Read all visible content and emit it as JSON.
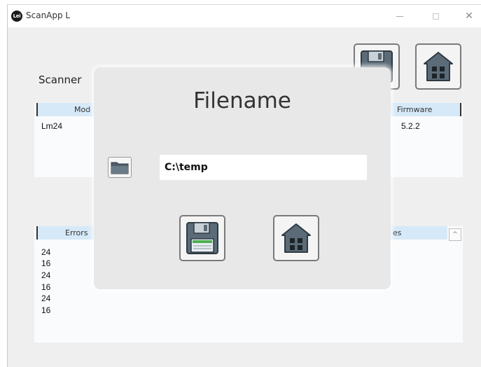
{
  "window": {
    "title": "ScanApp L",
    "icon_text": "Lei",
    "close_glyph": "✕"
  },
  "main": {
    "scanner_label": "Scanner",
    "top_table": {
      "headers": [
        "Mod",
        "Firmware"
      ],
      "rows": [
        [
          "Lm24",
          "5.2.2"
        ]
      ]
    },
    "bottom_table": {
      "headers": [
        "Errors",
        "es"
      ],
      "errors": [
        "24",
        "16",
        "24",
        "16",
        "24",
        "16"
      ]
    },
    "scroll_up_glyph": "^"
  },
  "dialog": {
    "title": "Filename",
    "path_value": "C:\\temp"
  },
  "colors": {
    "header_bg": "#d6e9f8",
    "icon_slate": "#5b6b78",
    "save_stripe": "#4caf50"
  },
  "icons": [
    "app-logo-icon",
    "minimize-icon",
    "maximize-icon",
    "close-icon",
    "save-icon",
    "home-icon",
    "folder-icon",
    "chevron-up-icon"
  ]
}
